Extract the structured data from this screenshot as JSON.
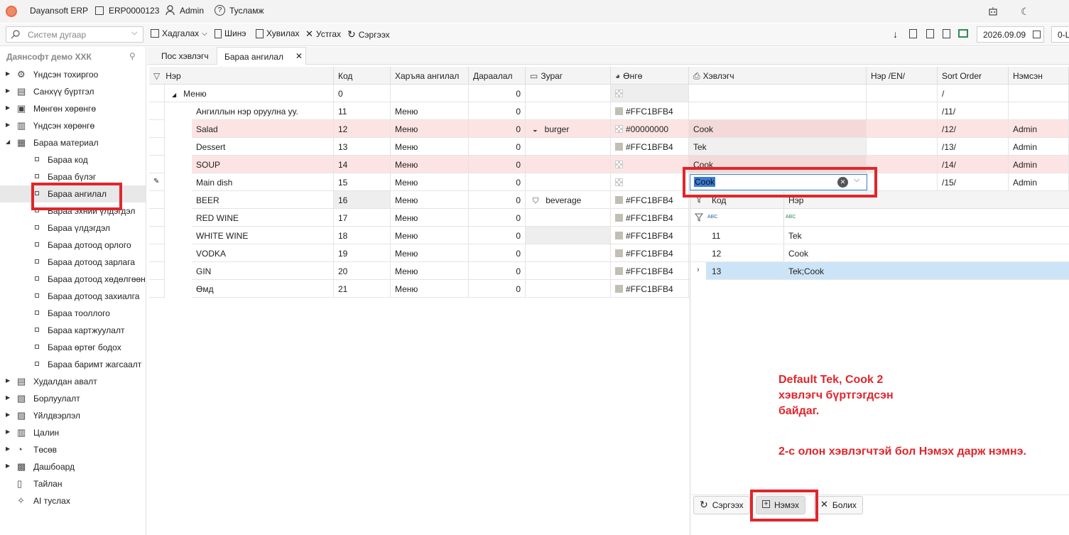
{
  "topbar": {
    "app_name": "Dayansoft ERP",
    "code": "ERP0000123",
    "user": "Admin",
    "help": "Тусламж"
  },
  "toolbar": {
    "search_placeholder": "Систем дугаар",
    "save": "Хадгалах",
    "new": "Шинэ",
    "copy": "Хувилах",
    "delete": "Устгах",
    "refresh": "Сэргээх",
    "date": "2026.09.09",
    "extra": "0-L"
  },
  "sidebar": {
    "company": "Даянсофт демо ХХК",
    "items": [
      {
        "label": "Үндсэн тохиргоо",
        "icon": "gear-icon",
        "expand": "collapsed"
      },
      {
        "label": "Санхүү бүртгэл",
        "icon": "ledger-icon",
        "expand": "collapsed"
      },
      {
        "label": "Мөнгөн хөрөнгө",
        "icon": "cash-icon",
        "expand": "collapsed"
      },
      {
        "label": "Үндсэн хөрөнгө",
        "icon": "building-icon",
        "expand": "collapsed"
      },
      {
        "label": "Бараа материал",
        "icon": "box-icon",
        "expand": "expanded"
      }
    ],
    "sub_items": [
      "Бараа код",
      "Бараа бүлэг",
      "Бараа ангилал",
      "Бараа эхний үлдэгдэл",
      "Бараа үлдэгдэл",
      "Бараа дотоод орлого",
      "Бараа дотоод зарлага",
      "Бараа дотоод хөдөлгөөн",
      "Бараа дотоод захиалга",
      "Бараа тооллого",
      "Бараа картжуулалт",
      "Бараа өртөг бодох",
      "Бараа баримт жагсаалт"
    ],
    "items_after": [
      {
        "label": "Худалдан авалт",
        "icon": "cart-icon",
        "expand": "collapsed"
      },
      {
        "label": "Борлуулалт",
        "icon": "sale-icon",
        "expand": "collapsed"
      },
      {
        "label": "Үйлдвэрлэл",
        "icon": "factory-icon",
        "expand": "collapsed"
      },
      {
        "label": "Цалин",
        "icon": "salary-icon",
        "expand": "collapsed"
      },
      {
        "label": "Төсөв",
        "icon": "pie-icon",
        "expand": "collapsed"
      },
      {
        "label": "Дашбоард",
        "icon": "dashboard-icon",
        "expand": "collapsed"
      },
      {
        "label": "Тайлан",
        "icon": "report-icon",
        "expand": "none"
      },
      {
        "label": "AI туслах",
        "icon": "ai-icon",
        "expand": "none"
      }
    ]
  },
  "tabs": [
    {
      "label": "Пос хэвлэгч"
    },
    {
      "label": "Бараа ангилал"
    }
  ],
  "grid": {
    "columns": [
      "Нэр",
      "Код",
      "Харъяа ангилал",
      "Дараалал",
      "Зураг",
      "Өнгө",
      "Хэвлэгч",
      "Нэр /EN/",
      "Sort Order",
      "Нэмсэн"
    ],
    "rows": [
      {
        "name": "Меню",
        "code": "0",
        "parent": "",
        "order": "0",
        "image": "",
        "color": "",
        "printer": "",
        "name_en": "",
        "sort": "/",
        "added": "",
        "level": 0
      },
      {
        "name": "Ангиллын нэр оруулна уу.",
        "code": "11",
        "parent": "Меню",
        "order": "0",
        "image": "",
        "color": "#FFC1BFB4",
        "printer": "",
        "name_en": "",
        "sort": "/11/",
        "added": "",
        "level": 1
      },
      {
        "name": "Salad",
        "code": "12",
        "parent": "Меню",
        "order": "0",
        "image": "burger",
        "color": "#00000000",
        "printer": "Cook",
        "name_en": "",
        "sort": "/12/",
        "added": "Admin",
        "level": 1,
        "highlight": true
      },
      {
        "name": "Dessert",
        "code": "13",
        "parent": "Меню",
        "order": "0",
        "image": "",
        "color": "#FFC1BFB4",
        "printer": "Tek",
        "name_en": "",
        "sort": "/13/",
        "added": "Admin",
        "level": 1
      },
      {
        "name": "SOUP",
        "code": "14",
        "parent": "Меню",
        "order": "0",
        "image": "",
        "color": "",
        "printer": "Cook",
        "name_en": "",
        "sort": "/14/",
        "added": "Admin",
        "level": 1,
        "highlight": true
      },
      {
        "name": "Main dish",
        "code": "15",
        "parent": "Меню",
        "order": "0",
        "image": "",
        "color": "",
        "printer": "",
        "name_en": "",
        "sort": "/15/",
        "added": "Admin",
        "level": 1
      },
      {
        "name": "BEER",
        "code": "16",
        "parent": "Меню",
        "order": "0",
        "image": "beverage",
        "color": "#FFC1BFB4",
        "printer": "",
        "name_en": "",
        "sort": "",
        "added": "",
        "level": 1
      },
      {
        "name": "RED WINE",
        "code": "17",
        "parent": "Меню",
        "order": "0",
        "image": "",
        "color": "#FFC1BFB4",
        "printer": "",
        "name_en": "",
        "sort": "",
        "added": "",
        "level": 1
      },
      {
        "name": "WHITE WINE",
        "code": "18",
        "parent": "Меню",
        "order": "0",
        "image": "",
        "color": "#FFC1BFB4",
        "printer": "",
        "name_en": "",
        "sort": "",
        "added": "",
        "level": 1
      },
      {
        "name": "VODKA",
        "code": "19",
        "parent": "Меню",
        "order": "0",
        "image": "",
        "color": "#FFC1BFB4",
        "printer": "",
        "name_en": "",
        "sort": "",
        "added": "",
        "level": 1
      },
      {
        "name": "GIN",
        "code": "20",
        "parent": "Меню",
        "order": "0",
        "image": "",
        "color": "#FFC1BFB4",
        "printer": "",
        "name_en": "",
        "sort": "",
        "added": "",
        "level": 1
      },
      {
        "name": "Өмд",
        "code": "21",
        "parent": "Меню",
        "order": "0",
        "image": "",
        "color": "#FFC1BFB4",
        "printer": "",
        "name_en": "",
        "sort": "",
        "added": "",
        "level": 1
      }
    ]
  },
  "dropdown": {
    "value": "Cook",
    "columns": [
      "Код",
      "Нэр"
    ],
    "filter_marks": [
      "ABC",
      "ABC"
    ],
    "rows": [
      {
        "code": "11",
        "name": "Tek"
      },
      {
        "code": "12",
        "name": "Cook"
      },
      {
        "code": "13",
        "name": "Tek;Cook"
      }
    ],
    "buttons": {
      "refresh": "Сэргээх",
      "add": "Нэмэх",
      "cancel": "Болих"
    }
  },
  "annotations": {
    "line1": "Default Tek, Cook 2",
    "line2": "хэвлэгч бүртгэгдсэн",
    "line3": "байдаг.",
    "line4": "2-с олон хэвлэгчтэй бол Нэмэх дарж нэмнэ."
  },
  "colors": {
    "accent": "#e0262b",
    "row_highlight": "#fde4e4",
    "selected_row": "#cce4f7",
    "swatch": "#c1bfb4"
  }
}
